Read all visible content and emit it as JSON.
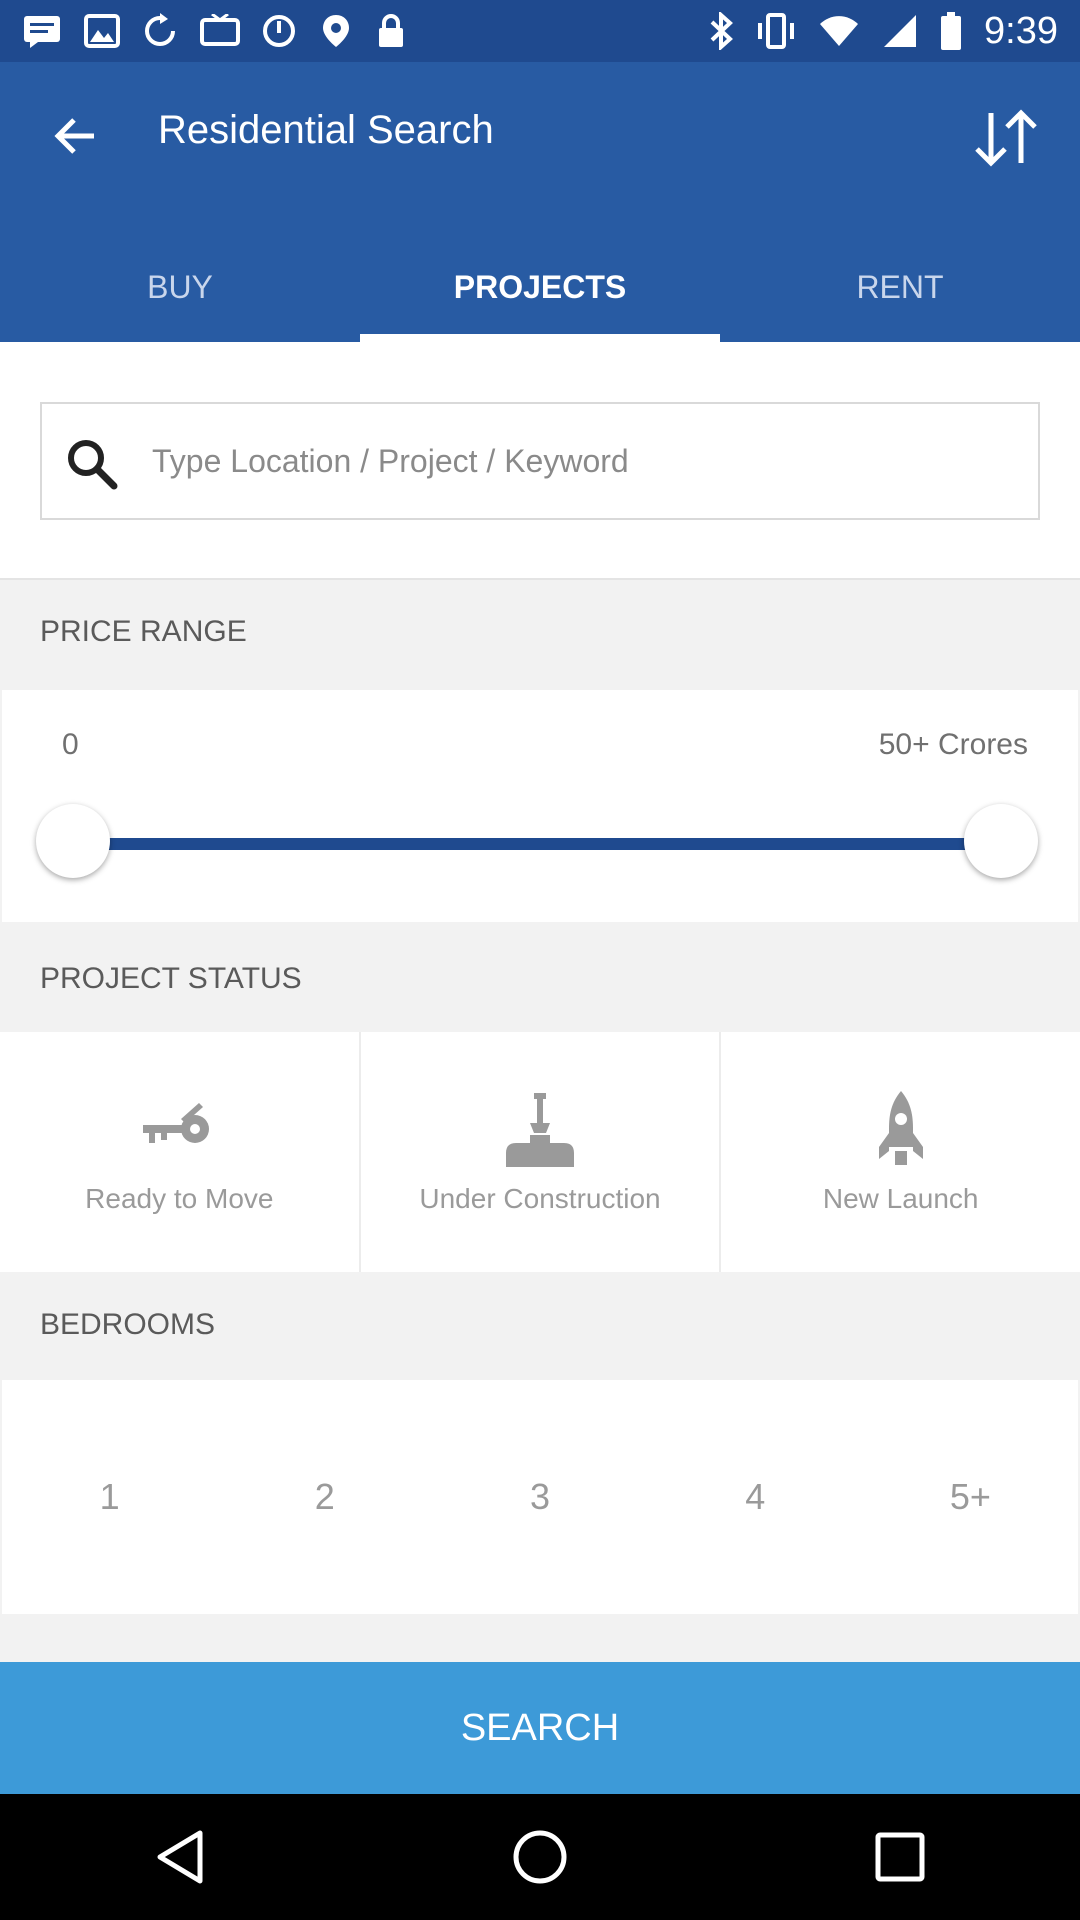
{
  "status_bar": {
    "time": "9:39",
    "left_icons": [
      "message-icon",
      "photo-icon",
      "refresh-icon",
      "tv-icon",
      "shield-icon",
      "location-icon",
      "lock-icon"
    ],
    "right_icons": [
      "bluetooth-icon",
      "vibrate-icon",
      "wifi-icon",
      "signal-icon",
      "battery-icon"
    ]
  },
  "header": {
    "title": "Residential Search",
    "back_icon": "arrow-back-icon",
    "sort_icon": "sort-icon"
  },
  "tabs": [
    {
      "label": "BUY",
      "active": false
    },
    {
      "label": "PROJECTS",
      "active": true
    },
    {
      "label": "RENT",
      "active": false
    }
  ],
  "search": {
    "placeholder": "Type Location / Project / Keyword",
    "value": ""
  },
  "price_range": {
    "heading": "PRICE RANGE",
    "min_label": "0",
    "max_label": "50+ Crores",
    "selected_min_fraction": 0,
    "selected_max_fraction": 1
  },
  "project_status": {
    "heading": "PROJECT STATUS",
    "items": [
      {
        "label": "Ready to Move",
        "icon": "key-icon"
      },
      {
        "label": "Under Construction",
        "icon": "construction-icon"
      },
      {
        "label": "New Launch",
        "icon": "rocket-icon"
      }
    ]
  },
  "bedrooms": {
    "heading": "BEDROOMS",
    "options": [
      "1",
      "2",
      "3",
      "4",
      "5+"
    ]
  },
  "search_button": {
    "label": "SEARCH"
  },
  "colors": {
    "status_bar": "#1f4a8f",
    "app_bar": "#285ba3",
    "slider": "#1f4a8f",
    "search_button": "#3d9ad8"
  }
}
